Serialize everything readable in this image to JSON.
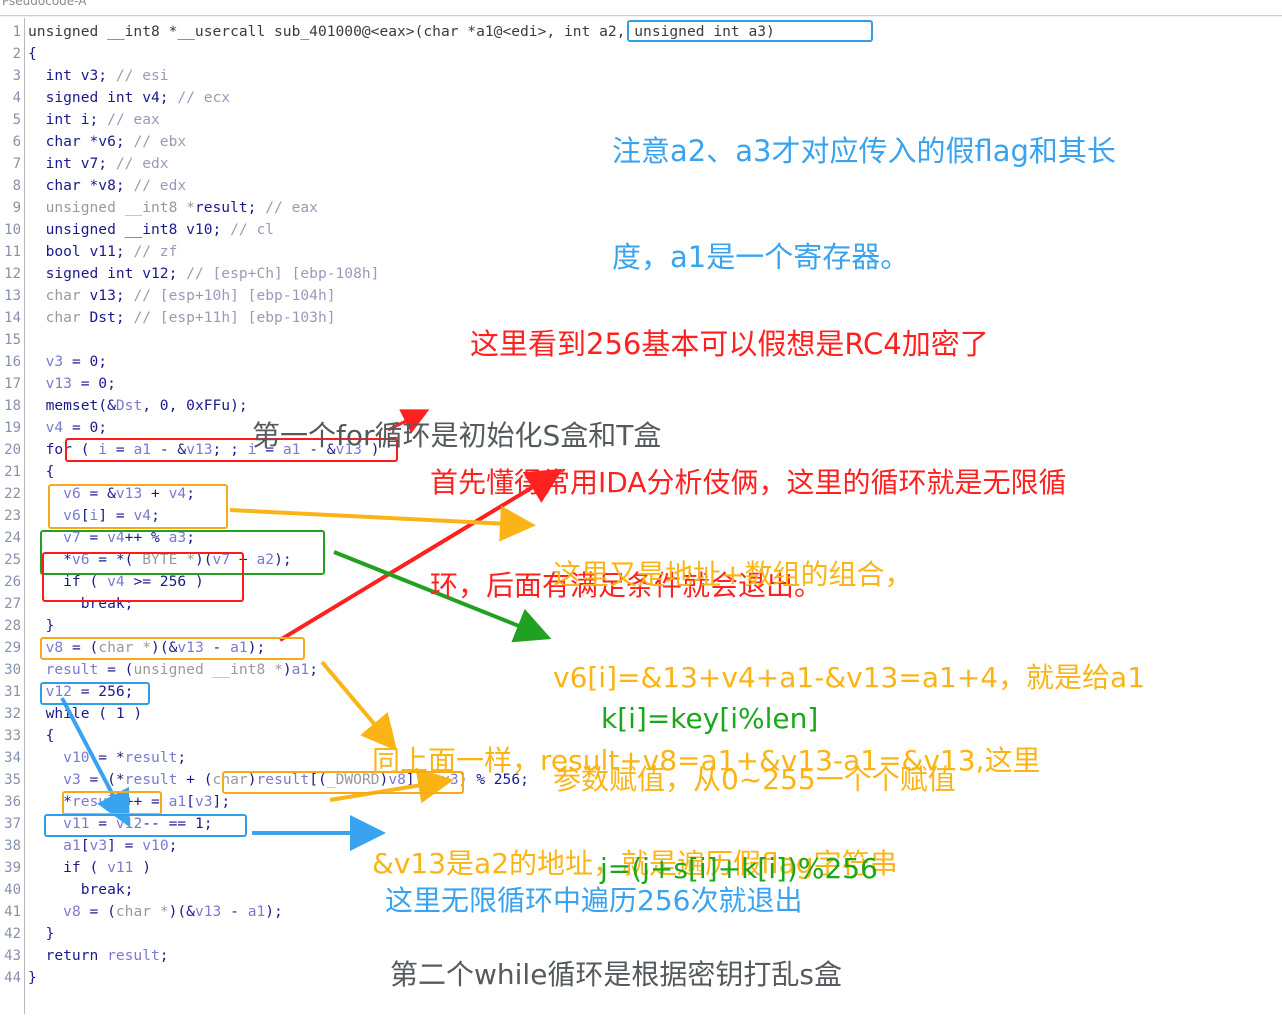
{
  "window": {
    "tab_label": "Pseudocode-A"
  },
  "code": {
    "lines": [
      {
        "n": "1",
        "tokens": [
          {
            "t": "unsigned __int8 *__usercall sub_401000@<eax>(char *a1@<edi>, int a2, unsigned int a3)",
            "c": "plain"
          }
        ]
      },
      {
        "n": "2",
        "tokens": [
          {
            "t": "{",
            "c": "kw"
          }
        ]
      },
      {
        "n": "3",
        "tokens": [
          {
            "t": "  int v3; ",
            "c": "kw"
          },
          {
            "t": "// esi",
            "c": "cmt"
          }
        ]
      },
      {
        "n": "4",
        "tokens": [
          {
            "t": "  signed int v4; ",
            "c": "kw"
          },
          {
            "t": "// ecx",
            "c": "cmt"
          }
        ]
      },
      {
        "n": "5",
        "tokens": [
          {
            "t": "  int i; ",
            "c": "kw"
          },
          {
            "t": "// eax",
            "c": "cmt"
          }
        ]
      },
      {
        "n": "6",
        "tokens": [
          {
            "t": "  char *v6; ",
            "c": "kw"
          },
          {
            "t": "// ebx",
            "c": "cmt"
          }
        ]
      },
      {
        "n": "7",
        "tokens": [
          {
            "t": "  int v7; ",
            "c": "kw"
          },
          {
            "t": "// edx",
            "c": "cmt"
          }
        ]
      },
      {
        "n": "8",
        "tokens": [
          {
            "t": "  char *v8; ",
            "c": "kw"
          },
          {
            "t": "// edx",
            "c": "cmt"
          }
        ]
      },
      {
        "n": "9",
        "tokens": [
          {
            "t": "  unsigned __int8 *",
            "c": "typ"
          },
          {
            "t": "result; ",
            "c": "kw"
          },
          {
            "t": "// eax",
            "c": "cmt"
          }
        ]
      },
      {
        "n": "10",
        "tokens": [
          {
            "t": "  unsigned __int8 v10; ",
            "c": "kw"
          },
          {
            "t": "// cl",
            "c": "cmt"
          }
        ]
      },
      {
        "n": "11",
        "tokens": [
          {
            "t": "  bool v11; ",
            "c": "kw"
          },
          {
            "t": "// zf",
            "c": "cmt"
          }
        ]
      },
      {
        "n": "12",
        "tokens": [
          {
            "t": "  signed int v12; ",
            "c": "kw"
          },
          {
            "t": "// [esp+Ch] [ebp-108h]",
            "c": "cmt"
          }
        ]
      },
      {
        "n": "13",
        "tokens": [
          {
            "t": "  char ",
            "c": "typ"
          },
          {
            "t": "v13; ",
            "c": "kw"
          },
          {
            "t": "// [esp+10h] [ebp-104h]",
            "c": "cmt"
          }
        ]
      },
      {
        "n": "14",
        "tokens": [
          {
            "t": "  char ",
            "c": "typ"
          },
          {
            "t": "Dst; ",
            "c": "kw"
          },
          {
            "t": "// [esp+11h] [ebp-103h]",
            "c": "cmt"
          }
        ]
      },
      {
        "n": "15",
        "tokens": [
          {
            "t": "",
            "c": "plain"
          }
        ]
      },
      {
        "n": "16",
        "tokens": [
          {
            "t": "  ",
            "c": "plain"
          },
          {
            "t": "v3",
            "c": "var"
          },
          {
            "t": " = 0;",
            "c": "kw"
          }
        ]
      },
      {
        "n": "17",
        "tokens": [
          {
            "t": "  ",
            "c": "plain"
          },
          {
            "t": "v13",
            "c": "var"
          },
          {
            "t": " = 0;",
            "c": "kw"
          }
        ]
      },
      {
        "n": "18",
        "tokens": [
          {
            "t": "  memset(&",
            "c": "kw"
          },
          {
            "t": "Dst",
            "c": "var"
          },
          {
            "t": ", 0, 0xFFu);",
            "c": "kw"
          }
        ]
      },
      {
        "n": "19",
        "tokens": [
          {
            "t": "  ",
            "c": "plain"
          },
          {
            "t": "v4",
            "c": "var"
          },
          {
            "t": " = 0;",
            "c": "kw"
          }
        ]
      },
      {
        "n": "20",
        "tokens": [
          {
            "t": "  for ( ",
            "c": "kw"
          },
          {
            "t": "i",
            "c": "var"
          },
          {
            "t": " = ",
            "c": "kw"
          },
          {
            "t": "a1",
            "c": "var"
          },
          {
            "t": " - &",
            "c": "kw"
          },
          {
            "t": "v13",
            "c": "var"
          },
          {
            "t": "; ; ",
            "c": "kw"
          },
          {
            "t": "i",
            "c": "var"
          },
          {
            "t": " = ",
            "c": "kw"
          },
          {
            "t": "a1",
            "c": "var"
          },
          {
            "t": " - &",
            "c": "kw"
          },
          {
            "t": "v13",
            "c": "var"
          },
          {
            "t": " )",
            "c": "kw"
          }
        ]
      },
      {
        "n": "21",
        "tokens": [
          {
            "t": "  {",
            "c": "kw"
          }
        ]
      },
      {
        "n": "22",
        "tokens": [
          {
            "t": "    ",
            "c": "plain"
          },
          {
            "t": "v6",
            "c": "var"
          },
          {
            "t": " = &",
            "c": "kw"
          },
          {
            "t": "v13",
            "c": "var"
          },
          {
            "t": " + ",
            "c": "kw"
          },
          {
            "t": "v4",
            "c": "var"
          },
          {
            "t": ";",
            "c": "kw"
          }
        ]
      },
      {
        "n": "23",
        "tokens": [
          {
            "t": "    ",
            "c": "plain"
          },
          {
            "t": "v6",
            "c": "var"
          },
          {
            "t": "[",
            "c": "kw"
          },
          {
            "t": "i",
            "c": "var"
          },
          {
            "t": "] = ",
            "c": "kw"
          },
          {
            "t": "v4",
            "c": "var"
          },
          {
            "t": ";",
            "c": "kw"
          }
        ]
      },
      {
        "n": "24",
        "tokens": [
          {
            "t": "    ",
            "c": "plain"
          },
          {
            "t": "v7",
            "c": "var"
          },
          {
            "t": " = ",
            "c": "kw"
          },
          {
            "t": "v4",
            "c": "var"
          },
          {
            "t": "++ % ",
            "c": "kw"
          },
          {
            "t": "a3",
            "c": "var"
          },
          {
            "t": ";",
            "c": "kw"
          }
        ]
      },
      {
        "n": "25",
        "tokens": [
          {
            "t": "    *",
            "c": "kw"
          },
          {
            "t": "v6",
            "c": "var"
          },
          {
            "t": " = *(",
            "c": "kw"
          },
          {
            "t": " BYTE *",
            "c": "typ"
          },
          {
            "t": ")(",
            "c": "kw"
          },
          {
            "t": "v7",
            "c": "var"
          },
          {
            "t": " + ",
            "c": "kw"
          },
          {
            "t": "a2",
            "c": "var"
          },
          {
            "t": ");",
            "c": "kw"
          }
        ]
      },
      {
        "n": "26",
        "tokens": [
          {
            "t": "    if ( ",
            "c": "kw"
          },
          {
            "t": "v4",
            "c": "var"
          },
          {
            "t": " >= 256 )",
            "c": "kw"
          }
        ]
      },
      {
        "n": "27",
        "tokens": [
          {
            "t": "      break;",
            "c": "kw"
          }
        ]
      },
      {
        "n": "28",
        "tokens": [
          {
            "t": "  }",
            "c": "kw"
          }
        ]
      },
      {
        "n": "29",
        "tokens": [
          {
            "t": "  ",
            "c": "plain"
          },
          {
            "t": "v8",
            "c": "var"
          },
          {
            "t": " = (",
            "c": "kw"
          },
          {
            "t": "char *",
            "c": "typ"
          },
          {
            "t": ")(&",
            "c": "kw"
          },
          {
            "t": "v13",
            "c": "var"
          },
          {
            "t": " - ",
            "c": "kw"
          },
          {
            "t": "a1",
            "c": "var"
          },
          {
            "t": ");",
            "c": "kw"
          }
        ]
      },
      {
        "n": "30",
        "tokens": [
          {
            "t": "  ",
            "c": "plain"
          },
          {
            "t": "result",
            "c": "var"
          },
          {
            "t": " = (",
            "c": "kw"
          },
          {
            "t": "unsigned __int8 *",
            "c": "typ"
          },
          {
            "t": ")",
            "c": "kw"
          },
          {
            "t": "a1",
            "c": "var"
          },
          {
            "t": ";",
            "c": "kw"
          }
        ]
      },
      {
        "n": "31",
        "tokens": [
          {
            "t": "  ",
            "c": "plain"
          },
          {
            "t": "v12",
            "c": "var"
          },
          {
            "t": " = 256;",
            "c": "kw"
          }
        ]
      },
      {
        "n": "32",
        "tokens": [
          {
            "t": "  while ( 1 )",
            "c": "kw"
          }
        ]
      },
      {
        "n": "33",
        "tokens": [
          {
            "t": "  {",
            "c": "kw"
          }
        ]
      },
      {
        "n": "34",
        "tokens": [
          {
            "t": "    ",
            "c": "plain"
          },
          {
            "t": "v10",
            "c": "var"
          },
          {
            "t": " = *",
            "c": "kw"
          },
          {
            "t": "result",
            "c": "var"
          },
          {
            "t": ";",
            "c": "kw"
          }
        ]
      },
      {
        "n": "35",
        "tokens": [
          {
            "t": "    ",
            "c": "plain"
          },
          {
            "t": "v3",
            "c": "var"
          },
          {
            "t": " = (*",
            "c": "kw"
          },
          {
            "t": "result",
            "c": "var"
          },
          {
            "t": " + (",
            "c": "kw"
          },
          {
            "t": "char",
            "c": "typ"
          },
          {
            "t": ")",
            "c": "kw"
          },
          {
            "t": "result",
            "c": "var"
          },
          {
            "t": "[(",
            "c": "kw"
          },
          {
            "t": "_DWORD",
            "c": "typ"
          },
          {
            "t": ")",
            "c": "kw"
          },
          {
            "t": "v8",
            "c": "var"
          },
          {
            "t": "] + ",
            "c": "kw"
          },
          {
            "t": "v3",
            "c": "var"
          },
          {
            "t": ") % 256;",
            "c": "kw"
          }
        ]
      },
      {
        "n": "36",
        "tokens": [
          {
            "t": "    *",
            "c": "kw"
          },
          {
            "t": "result",
            "c": "var"
          },
          {
            "t": "++ = ",
            "c": "kw"
          },
          {
            "t": "a1",
            "c": "var"
          },
          {
            "t": "[",
            "c": "kw"
          },
          {
            "t": "v3",
            "c": "var"
          },
          {
            "t": "];",
            "c": "kw"
          }
        ]
      },
      {
        "n": "37",
        "tokens": [
          {
            "t": "    ",
            "c": "plain"
          },
          {
            "t": "v11",
            "c": "var"
          },
          {
            "t": " = ",
            "c": "kw"
          },
          {
            "t": "v12",
            "c": "var"
          },
          {
            "t": "-- == 1;",
            "c": "kw"
          }
        ]
      },
      {
        "n": "38",
        "tokens": [
          {
            "t": "    ",
            "c": "plain"
          },
          {
            "t": "a1",
            "c": "var"
          },
          {
            "t": "[",
            "c": "kw"
          },
          {
            "t": "v3",
            "c": "var"
          },
          {
            "t": "] = ",
            "c": "kw"
          },
          {
            "t": "v10",
            "c": "var"
          },
          {
            "t": ";",
            "c": "kw"
          }
        ]
      },
      {
        "n": "39",
        "tokens": [
          {
            "t": "    if ( ",
            "c": "kw"
          },
          {
            "t": "v11",
            "c": "var"
          },
          {
            "t": " )",
            "c": "kw"
          }
        ]
      },
      {
        "n": "40",
        "tokens": [
          {
            "t": "      break;",
            "c": "kw"
          }
        ]
      },
      {
        "n": "41",
        "tokens": [
          {
            "t": "    ",
            "c": "plain"
          },
          {
            "t": "v8",
            "c": "var"
          },
          {
            "t": " = (",
            "c": "kw"
          },
          {
            "t": "char *",
            "c": "typ"
          },
          {
            "t": ")(&",
            "c": "kw"
          },
          {
            "t": "v13",
            "c": "var"
          },
          {
            "t": " - ",
            "c": "kw"
          },
          {
            "t": "a1",
            "c": "var"
          },
          {
            "t": ");",
            "c": "kw"
          }
        ]
      },
      {
        "n": "42",
        "tokens": [
          {
            "t": "  }",
            "c": "kw"
          }
        ]
      },
      {
        "n": "43",
        "tokens": [
          {
            "t": "  return ",
            "c": "kw"
          },
          {
            "t": "result",
            "c": "var"
          },
          {
            "t": ";",
            "c": "kw"
          }
        ]
      },
      {
        "n": "44",
        "tokens": [
          {
            "t": "}",
            "c": "kw"
          }
        ]
      }
    ]
  },
  "annotations": {
    "note_params": {
      "line1": "注意a2、a3才对应传入的假flag和其长",
      "line2": "度，a1是一个寄存器。",
      "color": "#3aa3ef"
    },
    "note_rc4": {
      "line1": "这里看到256基本可以假想是RC4加密了",
      "color": "#ff2020"
    },
    "note_first_for": {
      "line1": "第一个for循环是初始化S盒和T盒",
      "color": "#555a5e"
    },
    "note_infinite_loop": {
      "line1": "首先懂得常用IDA分析伎俩，这里的循环就是无限循",
      "line2": "环，后面有满足条件就会退出。",
      "color": "#ff2020"
    },
    "note_addr_array": {
      "line1": "这里又是地址+数组的组合，",
      "line2": "v6[i]=&13+v4+a1-&v13=a1+4，就是给a1",
      "line3": "参数赋值，从0~255一个个赋值",
      "color": "#fbb415"
    },
    "note_k_formula": {
      "line1": "k[i]=key[i%len]",
      "color": "#1aa81a"
    },
    "note_same_as_above": {
      "line1": "同上面一样，result+v8=a1+&v13-a1=&v13,这里",
      "line2": "&v13是a2的地址，就是遍历假flag字符串",
      "color": "#fbb415"
    },
    "note_j_formula": {
      "line1": "j=(j+s[i]+k[i])%256",
      "color": "#1aa81a"
    },
    "note_256_exit": {
      "line1": "这里无限循环中遍历256次就退出",
      "color": "#3aa3ef"
    },
    "note_second_while": {
      "line1": "第二个while循环是根据密钥打乱s盒",
      "color": "#555a5e"
    }
  },
  "highlight_boxes": [
    {
      "name": "box-args-a2-a3",
      "color": "#2f9ee8"
    },
    {
      "name": "box-for-init",
      "color": "#ff1a1a"
    },
    {
      "name": "box-v6-assign",
      "color": "#f5a91b"
    },
    {
      "name": "box-v7-mod-a3",
      "color": "#21a121"
    },
    {
      "name": "box-if-break-256",
      "color": "#ff1a1a"
    },
    {
      "name": "box-v8-cast",
      "color": "#f5a91b"
    },
    {
      "name": "box-v12-256",
      "color": "#2f9ee8"
    },
    {
      "name": "box-result-index-v8",
      "color": "#f5a91b"
    },
    {
      "name": "box-result-incr",
      "color": "#f5a91b"
    },
    {
      "name": "box-v11-v12-dec",
      "color": "#2f9ee8"
    }
  ]
}
